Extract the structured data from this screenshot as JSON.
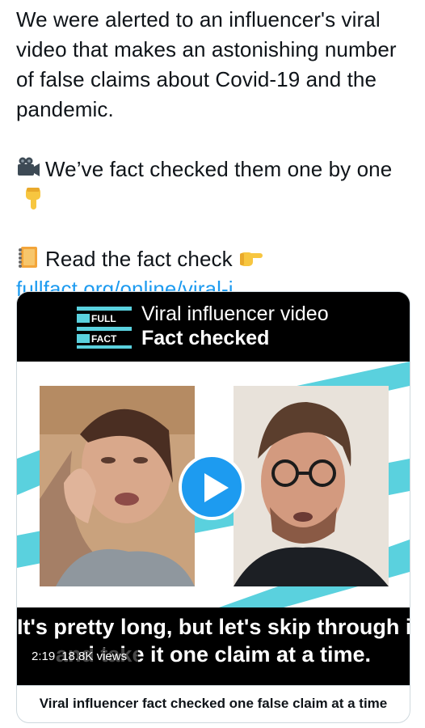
{
  "tweet": {
    "line1": "We were alerted to an influencer's viral video that makes an astonishing number of false claims about Covid-19 and the pandemic.",
    "line2": "We’ve fact checked them one by one",
    "line3": "Read the fact check",
    "link": "fullfact.org/online/viral-i...",
    "icons": [
      "video-camera-icon",
      "pointing-down-icon",
      "notebook-icon",
      "pointing-right-icon"
    ]
  },
  "card": {
    "banner_line1": "Viral influencer video",
    "banner_line2": "Fact checked",
    "logo_text_top": "FULL",
    "logo_text_bottom": "FACT",
    "caption_line1": "It's pretty long, but let's skip through it",
    "caption_line2": "and take it one claim at a time.",
    "duration": "2:19",
    "views": "18.8K views",
    "title": "Viral influencer fact checked one false claim at a time",
    "colors": {
      "accent_teal": "#5ad1de",
      "play_blue": "#1d9bf0",
      "link_blue": "#1d9bf0"
    }
  }
}
